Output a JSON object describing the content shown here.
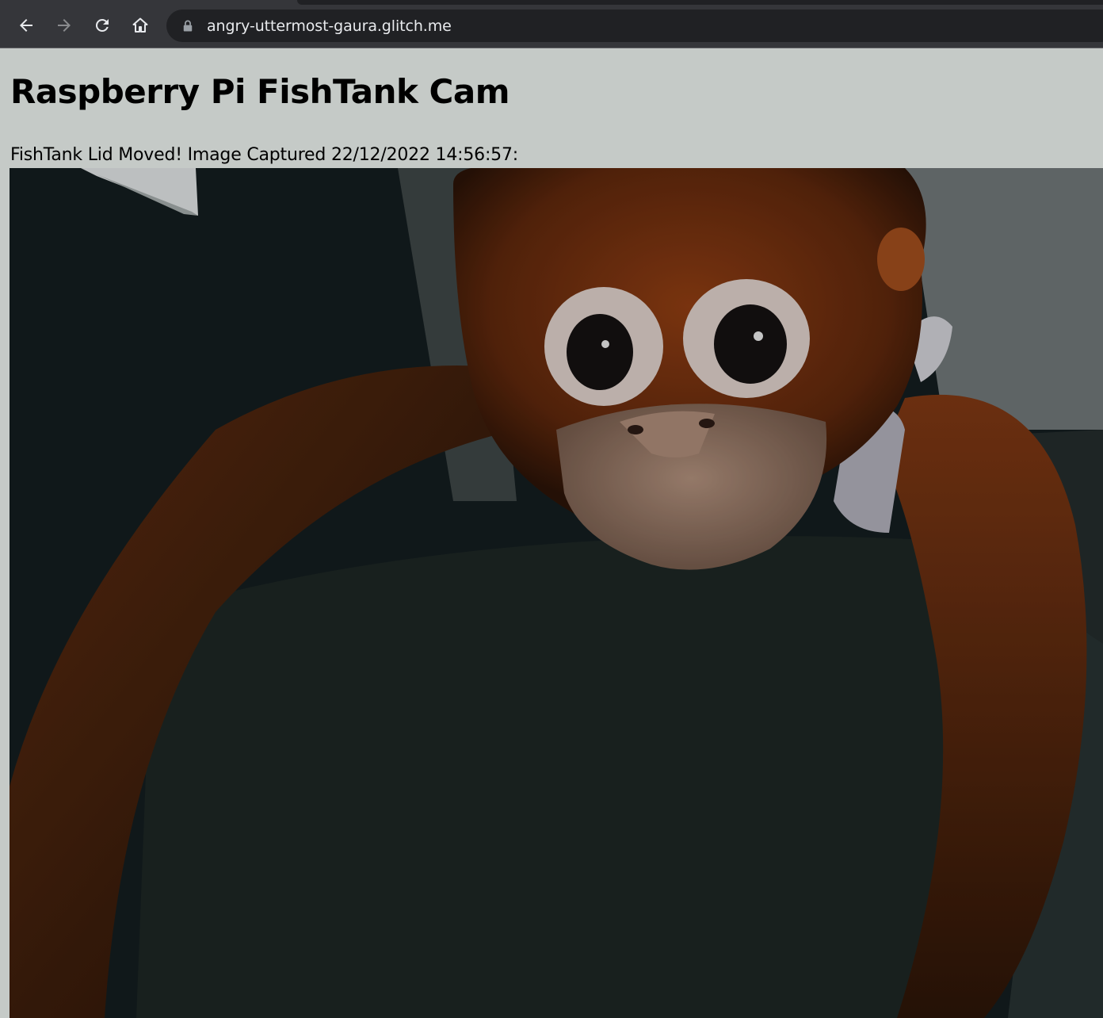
{
  "browser": {
    "url": "angry-uttermost-gaura.glitch.me",
    "icons": {
      "back": "arrow-left-icon",
      "forward": "arrow-right-icon",
      "reload": "reload-icon",
      "home": "home-icon",
      "lock": "lock-icon"
    }
  },
  "page": {
    "title": "Raspberry Pi FishTank Cam",
    "caption": "FishTank Lid Moved! Image Captured 22/12/2022 14:56:57:",
    "background": "#c5cac7"
  },
  "image": {
    "subject": "captured-camera-photo"
  }
}
